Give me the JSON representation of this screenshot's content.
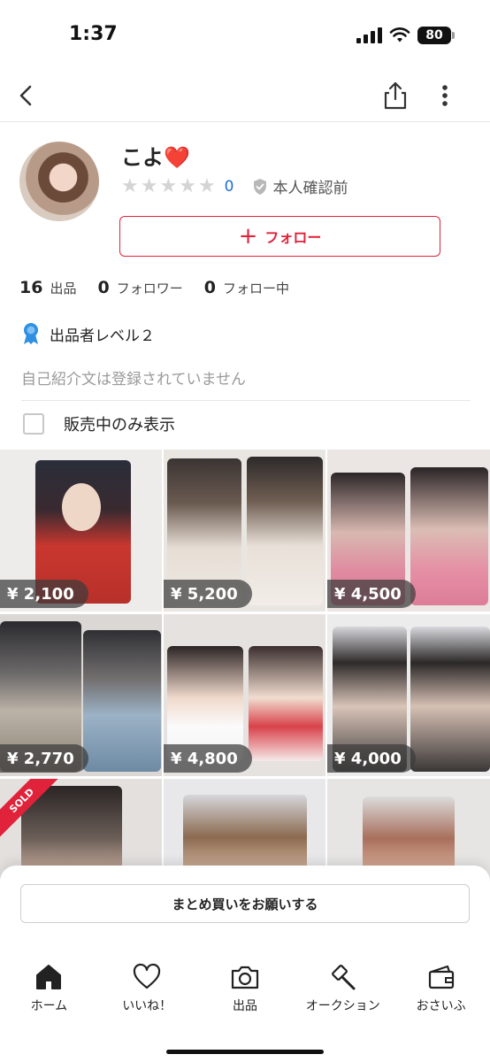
{
  "status_bar": {
    "time": "1:37",
    "battery": "80"
  },
  "profile": {
    "name": "こよ",
    "name_emoji": "❤️",
    "rating_count": "0",
    "verification": "本人確認前",
    "follow_label": "フォロー"
  },
  "stats": [
    {
      "value": "16",
      "label": "出品"
    },
    {
      "value": "0",
      "label": "フォロワー"
    },
    {
      "value": "0",
      "label": "フォロー中"
    }
  ],
  "seller_level": "出品者レベル２",
  "bio_placeholder": "自己紹介文は登録されていません",
  "filter_label": "販売中のみ表示",
  "items": [
    {
      "price": "¥ 2,100"
    },
    {
      "price": "¥ 5,200"
    },
    {
      "price": "¥ 4,500"
    },
    {
      "price": "¥ 2,770"
    },
    {
      "price": "¥ 4,800"
    },
    {
      "price": "¥ 4,000"
    },
    {
      "sold_label": "SOLD"
    },
    {},
    {}
  ],
  "bulk_buy_label": "まとめ買いをお願いする",
  "tabs": [
    {
      "label": "ホーム",
      "icon": "home-icon"
    },
    {
      "label": "いいね！",
      "icon": "heart-icon"
    },
    {
      "label": "出品",
      "icon": "camera-icon"
    },
    {
      "label": "オークション",
      "icon": "auction-hammer-icon"
    },
    {
      "label": "おさいふ",
      "icon": "wallet-icon"
    }
  ],
  "colors": {
    "accent": "#e0223a",
    "link": "#1f6fd1",
    "medal": "#2f8fe0"
  }
}
